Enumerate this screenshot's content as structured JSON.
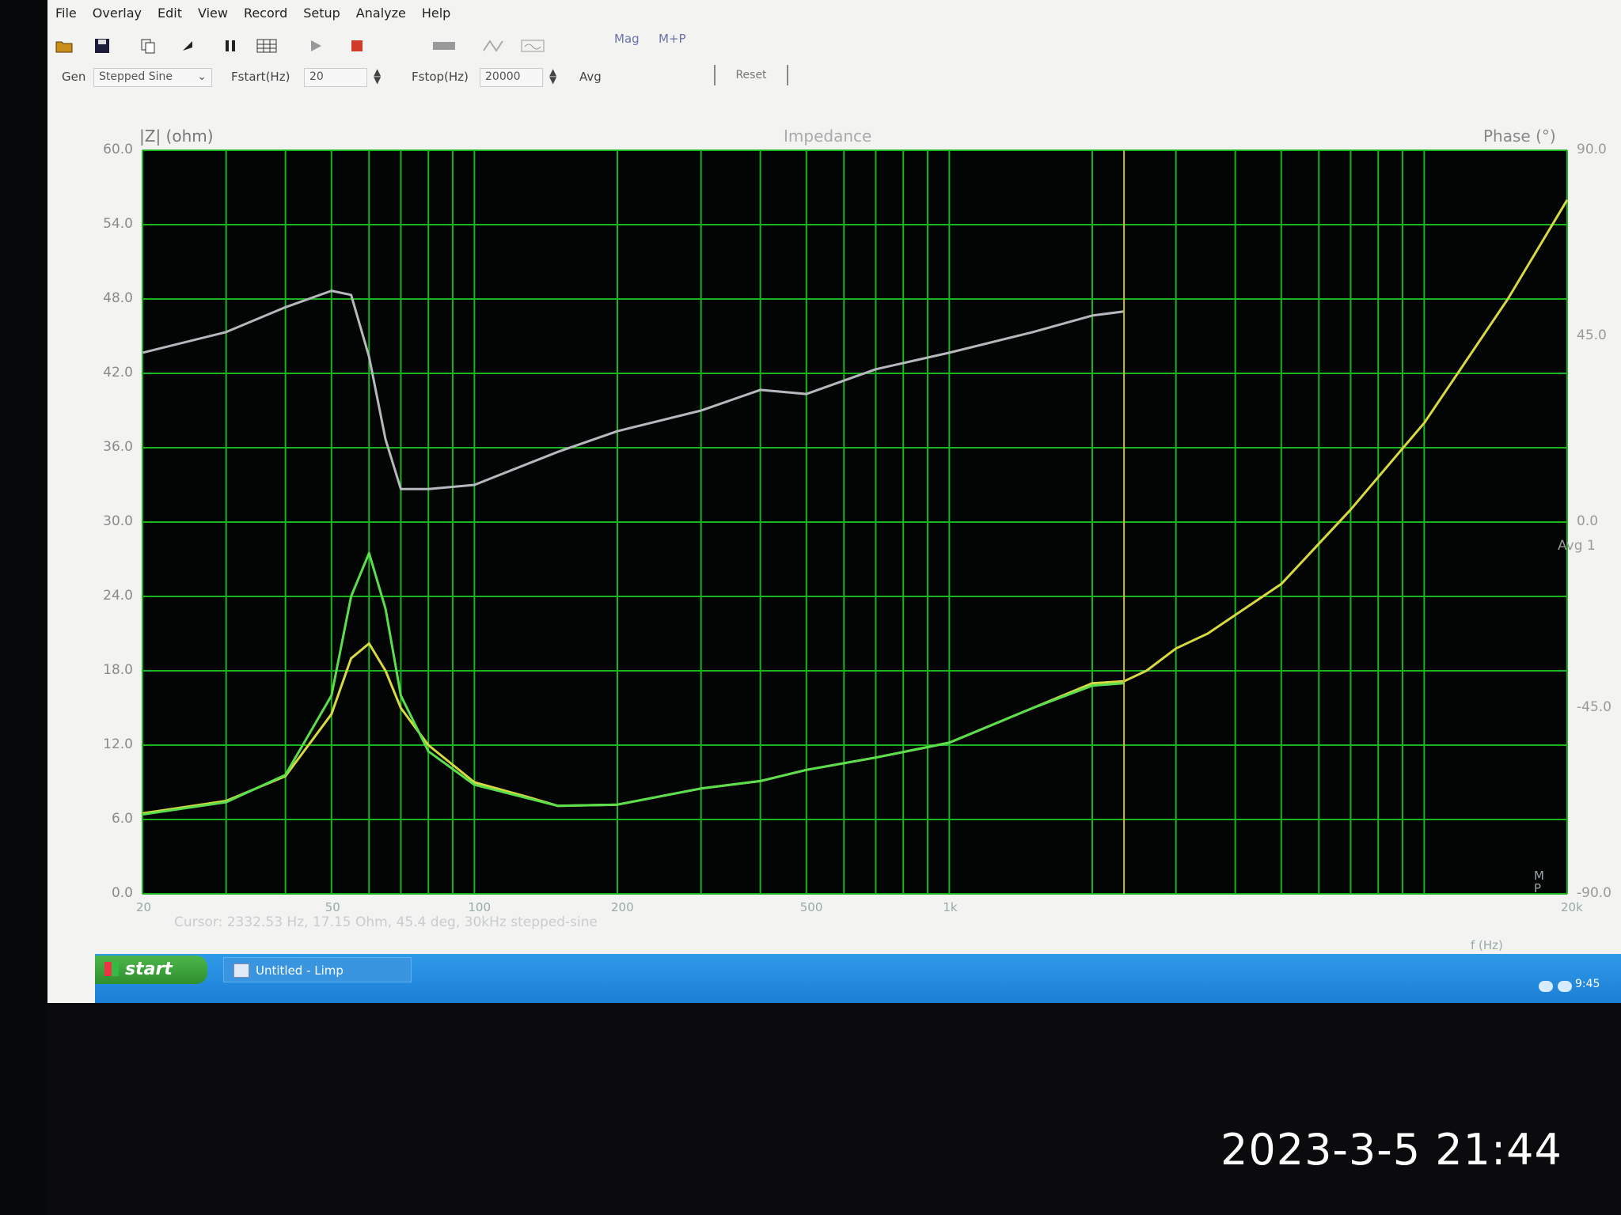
{
  "photo": {
    "timestamp": "2023-3-5 21:44"
  },
  "menubar": {
    "items": [
      "File",
      "Overlay",
      "Edit",
      "View",
      "Record",
      "Setup",
      "Analyze",
      "Help"
    ]
  },
  "toolbar": {
    "icons": [
      "open-folder-icon",
      "save-disk-icon",
      "copy-icon",
      "arrow-icon",
      "pause-icon",
      "grid-icon",
      "play-icon",
      "stop-icon",
      "bar-icon",
      "scale-icon",
      "wave-icon"
    ],
    "mag_label": "Mag",
    "mp_label": "M+P"
  },
  "controls": {
    "gen_label": "Gen",
    "gen_value": "Stepped Sine",
    "fstart_label": "Fstart(Hz)",
    "fstart_value": "20",
    "fstop_label": "Fstop(Hz)",
    "fstop_value": "20000",
    "avg_label": "Avg",
    "reset_label": "Reset"
  },
  "chart": {
    "title": "Impedance",
    "y_title": "|Z| (ohm)",
    "phase_title": "Phase (°)",
    "left_ticks": [
      "60.0",
      "54.0",
      "48.0",
      "42.0",
      "36.0",
      "30.0",
      "24.0",
      "18.0",
      "12.0",
      "6.0",
      "0.0"
    ],
    "right_ticks": [
      "90.0",
      "45.0",
      "0.0",
      "-45.0",
      "-90.0"
    ],
    "right_extra": "Avg 1",
    "x_ticks": [
      "20",
      "50",
      "100",
      "200",
      "500",
      "1k",
      "20k"
    ],
    "x_unit": "f (Hz)",
    "cursor_readout": "Cursor: 2332.53 Hz, 17.15 Ohm, 45.4 deg, 30kHz stepped-sine",
    "m_label": "M",
    "p_label": "P",
    "colors": {
      "background": "#030404",
      "grid": "#19b41e",
      "magnitude": "#d8d840",
      "reference": "#5ade4c",
      "phase": "#b5b8bc",
      "cursor": "#c8b832"
    }
  },
  "chart_data": {
    "type": "line",
    "title": "Impedance",
    "xlabel": "f (Hz)",
    "ylabel": "|Z| (ohm)",
    "y2label": "Phase (°)",
    "xscale": "log",
    "xlim": [
      20,
      20000
    ],
    "ylim": [
      0,
      60
    ],
    "y2lim": [
      -90,
      90
    ],
    "grid": true,
    "cursor_x": 2332.53,
    "series": [
      {
        "color": "#d8d840",
        "x": [
          20,
          30,
          40,
          50,
          55,
          60,
          65,
          70,
          80,
          100,
          130,
          150,
          200,
          300,
          400,
          500,
          700,
          1000,
          1500,
          2000,
          2332,
          2600,
          3000,
          3500,
          4000,
          5000,
          7000,
          10000,
          15000,
          20000
        ],
        "y": [
          6.5,
          7.5,
          9.5,
          14.5,
          19,
          20.2,
          18,
          15,
          12,
          9,
          7.8,
          7.1,
          7.2,
          8.5,
          9.1,
          10,
          11,
          12.2,
          15,
          17,
          17.15,
          18,
          19.8,
          21,
          22.5,
          25,
          31,
          38,
          48,
          56
        ]
      },
      {
        "color": "#5ade4c",
        "x": [
          20,
          30,
          40,
          50,
          55,
          60,
          65,
          70,
          80,
          100,
          130,
          150,
          200,
          300,
          400,
          500,
          700,
          1000,
          1500,
          2000,
          2332
        ],
        "y": [
          6.4,
          7.4,
          9.6,
          16,
          24,
          27.5,
          23,
          16,
          11.5,
          8.8,
          7.7,
          7.1,
          7.2,
          8.5,
          9.1,
          10,
          11,
          12.2,
          15,
          16.8,
          17
        ]
      },
      {
        "color": "#b5b8bc",
        "axis": "phase",
        "x": [
          20,
          30,
          40,
          50,
          55,
          60,
          65,
          70,
          80,
          100,
          150,
          200,
          300,
          400,
          500,
          700,
          1000,
          1500,
          2000,
          2332
        ],
        "y": [
          41,
          46,
          52,
          56,
          55,
          40,
          20,
          8,
          8,
          9,
          17,
          22,
          27,
          32,
          31,
          37,
          41,
          46,
          50,
          51
        ]
      }
    ]
  }
}
